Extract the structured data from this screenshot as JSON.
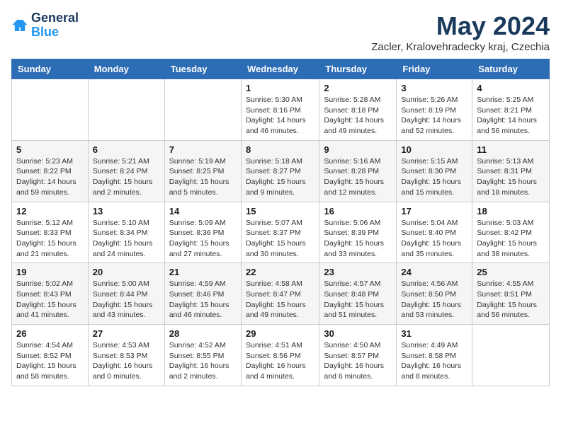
{
  "logo": {
    "line1": "General",
    "line2": "Blue"
  },
  "title": "May 2024",
  "location": "Zacler, Kralovehradecky kraj, Czechia",
  "weekdays": [
    "Sunday",
    "Monday",
    "Tuesday",
    "Wednesday",
    "Thursday",
    "Friday",
    "Saturday"
  ],
  "weeks": [
    [
      {
        "day": "",
        "info": ""
      },
      {
        "day": "",
        "info": ""
      },
      {
        "day": "",
        "info": ""
      },
      {
        "day": "1",
        "info": "Sunrise: 5:30 AM\nSunset: 8:16 PM\nDaylight: 14 hours\nand 46 minutes."
      },
      {
        "day": "2",
        "info": "Sunrise: 5:28 AM\nSunset: 8:18 PM\nDaylight: 14 hours\nand 49 minutes."
      },
      {
        "day": "3",
        "info": "Sunrise: 5:26 AM\nSunset: 8:19 PM\nDaylight: 14 hours\nand 52 minutes."
      },
      {
        "day": "4",
        "info": "Sunrise: 5:25 AM\nSunset: 8:21 PM\nDaylight: 14 hours\nand 56 minutes."
      }
    ],
    [
      {
        "day": "5",
        "info": "Sunrise: 5:23 AM\nSunset: 8:22 PM\nDaylight: 14 hours\nand 59 minutes."
      },
      {
        "day": "6",
        "info": "Sunrise: 5:21 AM\nSunset: 8:24 PM\nDaylight: 15 hours\nand 2 minutes."
      },
      {
        "day": "7",
        "info": "Sunrise: 5:19 AM\nSunset: 8:25 PM\nDaylight: 15 hours\nand 5 minutes."
      },
      {
        "day": "8",
        "info": "Sunrise: 5:18 AM\nSunset: 8:27 PM\nDaylight: 15 hours\nand 9 minutes."
      },
      {
        "day": "9",
        "info": "Sunrise: 5:16 AM\nSunset: 8:28 PM\nDaylight: 15 hours\nand 12 minutes."
      },
      {
        "day": "10",
        "info": "Sunrise: 5:15 AM\nSunset: 8:30 PM\nDaylight: 15 hours\nand 15 minutes."
      },
      {
        "day": "11",
        "info": "Sunrise: 5:13 AM\nSunset: 8:31 PM\nDaylight: 15 hours\nand 18 minutes."
      }
    ],
    [
      {
        "day": "12",
        "info": "Sunrise: 5:12 AM\nSunset: 8:33 PM\nDaylight: 15 hours\nand 21 minutes."
      },
      {
        "day": "13",
        "info": "Sunrise: 5:10 AM\nSunset: 8:34 PM\nDaylight: 15 hours\nand 24 minutes."
      },
      {
        "day": "14",
        "info": "Sunrise: 5:09 AM\nSunset: 8:36 PM\nDaylight: 15 hours\nand 27 minutes."
      },
      {
        "day": "15",
        "info": "Sunrise: 5:07 AM\nSunset: 8:37 PM\nDaylight: 15 hours\nand 30 minutes."
      },
      {
        "day": "16",
        "info": "Sunrise: 5:06 AM\nSunset: 8:39 PM\nDaylight: 15 hours\nand 33 minutes."
      },
      {
        "day": "17",
        "info": "Sunrise: 5:04 AM\nSunset: 8:40 PM\nDaylight: 15 hours\nand 35 minutes."
      },
      {
        "day": "18",
        "info": "Sunrise: 5:03 AM\nSunset: 8:42 PM\nDaylight: 15 hours\nand 38 minutes."
      }
    ],
    [
      {
        "day": "19",
        "info": "Sunrise: 5:02 AM\nSunset: 8:43 PM\nDaylight: 15 hours\nand 41 minutes."
      },
      {
        "day": "20",
        "info": "Sunrise: 5:00 AM\nSunset: 8:44 PM\nDaylight: 15 hours\nand 43 minutes."
      },
      {
        "day": "21",
        "info": "Sunrise: 4:59 AM\nSunset: 8:46 PM\nDaylight: 15 hours\nand 46 minutes."
      },
      {
        "day": "22",
        "info": "Sunrise: 4:58 AM\nSunset: 8:47 PM\nDaylight: 15 hours\nand 49 minutes."
      },
      {
        "day": "23",
        "info": "Sunrise: 4:57 AM\nSunset: 8:48 PM\nDaylight: 15 hours\nand 51 minutes."
      },
      {
        "day": "24",
        "info": "Sunrise: 4:56 AM\nSunset: 8:50 PM\nDaylight: 15 hours\nand 53 minutes."
      },
      {
        "day": "25",
        "info": "Sunrise: 4:55 AM\nSunset: 8:51 PM\nDaylight: 15 hours\nand 56 minutes."
      }
    ],
    [
      {
        "day": "26",
        "info": "Sunrise: 4:54 AM\nSunset: 8:52 PM\nDaylight: 15 hours\nand 58 minutes."
      },
      {
        "day": "27",
        "info": "Sunrise: 4:53 AM\nSunset: 8:53 PM\nDaylight: 16 hours\nand 0 minutes."
      },
      {
        "day": "28",
        "info": "Sunrise: 4:52 AM\nSunset: 8:55 PM\nDaylight: 16 hours\nand 2 minutes."
      },
      {
        "day": "29",
        "info": "Sunrise: 4:51 AM\nSunset: 8:56 PM\nDaylight: 16 hours\nand 4 minutes."
      },
      {
        "day": "30",
        "info": "Sunrise: 4:50 AM\nSunset: 8:57 PM\nDaylight: 16 hours\nand 6 minutes."
      },
      {
        "day": "31",
        "info": "Sunrise: 4:49 AM\nSunset: 8:58 PM\nDaylight: 16 hours\nand 8 minutes."
      },
      {
        "day": "",
        "info": ""
      }
    ]
  ]
}
